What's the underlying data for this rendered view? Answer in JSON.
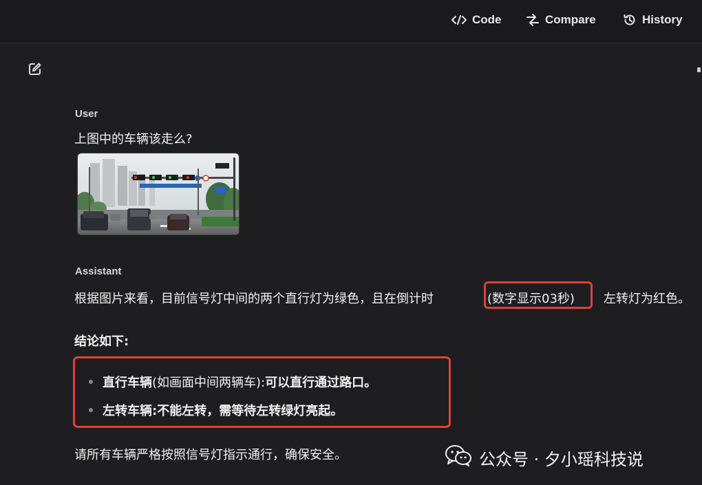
{
  "toolbar": {
    "code_label": "Code",
    "compare_label": "Compare",
    "history_label": "History"
  },
  "conversation": {
    "user_role": "User",
    "user_message": "上图中的车辆该走么?",
    "assistant_role": "Assistant",
    "assistant_intro_before": "根据图片来看，目前信号灯中间的两个直行灯为绿色，且在倒计时",
    "assistant_intro_highlight": "(数字显示03秒)",
    "assistant_intro_after": "左转灯为红色。",
    "conclusion_heading": "结论如下:",
    "bullets": [
      {
        "label": "直行车辆",
        "detail": "(如画面中间两辆车):",
        "action": "可以直行通过路口。"
      },
      {
        "label": "左转车辆:",
        "detail": "",
        "action": "不能左转，需等待左转绿灯亮起。"
      }
    ],
    "closing": "请所有车辆严格按照信号灯指示通行，确保安全。"
  },
  "watermark": {
    "text": "公众号 · 夕小瑶科技说"
  },
  "colors": {
    "background": "#1e1e20",
    "highlight_border": "#e0403a"
  }
}
